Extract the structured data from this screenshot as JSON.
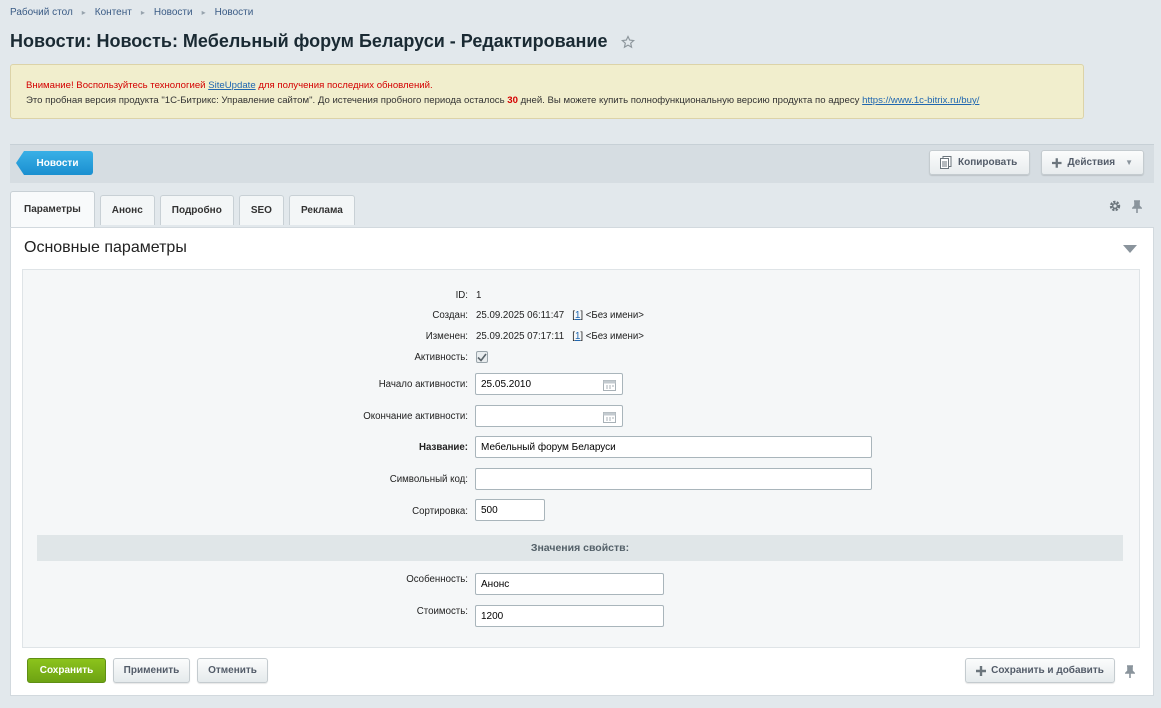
{
  "breadcrumbs": [
    "Рабочий стол",
    "Контент",
    "Новости",
    "Новости"
  ],
  "page_title": "Новости: Новость: Мебельный форум Беларуси - Редактирование",
  "notice": {
    "warn_prefix": "Внимание! Воспользуйтесь технологией ",
    "warn_link": "SiteUpdate",
    "warn_suffix": " для получения последних обновлений.",
    "info_prefix": "Это пробная версия продукта \"1С-Битрикс: Управление сайтом\". До истечения пробного периода осталось ",
    "days": "30",
    "info_middle": " дней. Вы можете купить полнофункциональную версию продукта по адресу ",
    "info_link": "https://www.1c-bitrix.ru/buy/"
  },
  "toolbar": {
    "back_label": "Новости",
    "copy_label": "Копировать",
    "actions_label": "Действия"
  },
  "tabs": [
    "Параметры",
    "Анонс",
    "Подробно",
    "SEO",
    "Реклама"
  ],
  "section_title": "Основные параметры",
  "fields": {
    "id_label": "ID:",
    "id_value": "1",
    "created_label": "Создан:",
    "created_value": "25.09.2025 06:11:47",
    "created_user_id": "1",
    "created_user_name": "<Без имени>",
    "modified_label": "Изменен:",
    "modified_value": "25.09.2025 07:17:11",
    "modified_user_id": "1",
    "modified_user_name": "<Без имени>",
    "active_label": "Активность:",
    "active_from_label": "Начало активности:",
    "active_from_value": "25.05.2010",
    "active_to_label": "Окончание активности:",
    "active_to_value": "",
    "name_label": "Название:",
    "name_value": "Мебельный форум Беларуси",
    "code_label": "Символьный код:",
    "code_value": "",
    "sort_label": "Сортировка:",
    "sort_value": "500"
  },
  "properties": {
    "header": "Значения свойств:",
    "feature_label": "Особенность:",
    "feature_value": "Анонс",
    "price_label": "Стоимость:",
    "price_value": "1200"
  },
  "buttons": {
    "save": "Сохранить",
    "apply": "Применить",
    "cancel": "Отменить",
    "save_add": "Сохранить и добавить"
  }
}
